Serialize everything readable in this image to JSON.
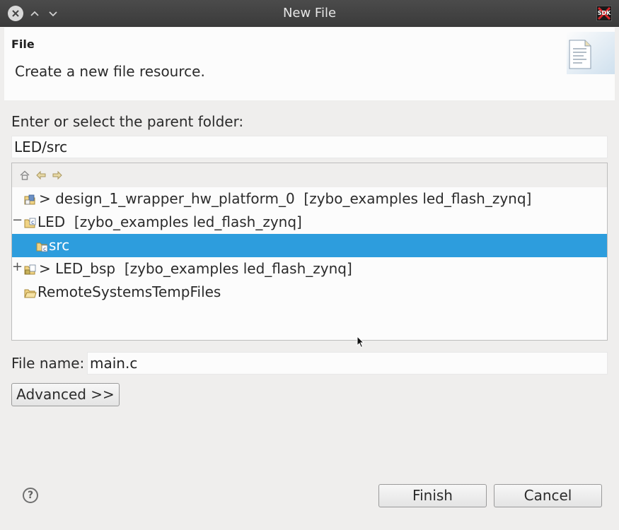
{
  "window": {
    "title": "New File"
  },
  "header": {
    "heading": "File",
    "description": "Create a new file resource."
  },
  "parent_folder": {
    "label": "Enter or select the parent folder:",
    "value": "LED/src"
  },
  "tree": {
    "items": [
      {
        "expander": "",
        "label": "> design_1_wrapper_hw_platform_0  [zybo_examples led_flash_zynq]",
        "icon": "hw-project-icon",
        "selected": false
      },
      {
        "expander": "−",
        "label": "LED  [zybo_examples led_flash_zynq]",
        "icon": "c-project-icon",
        "selected": false
      },
      {
        "expander": "",
        "label": "src",
        "icon": "source-folder-icon",
        "selected": true
      },
      {
        "expander": "+",
        "label": "> LED_bsp  [zybo_examples led_flash_zynq]",
        "icon": "bsp-project-icon",
        "selected": false
      },
      {
        "expander": "",
        "label": "RemoteSystemsTempFiles",
        "icon": "folder-icon",
        "selected": false
      }
    ]
  },
  "file_name": {
    "label": "File name:",
    "value": "main.c"
  },
  "buttons": {
    "advanced": "Advanced >>",
    "finish": "Finish",
    "cancel": "Cancel"
  },
  "logo": {
    "text": "SDK"
  },
  "colors": {
    "selection": "#2d9ddd",
    "titlebar": "#3f3f3f",
    "background": "#efeeed"
  }
}
